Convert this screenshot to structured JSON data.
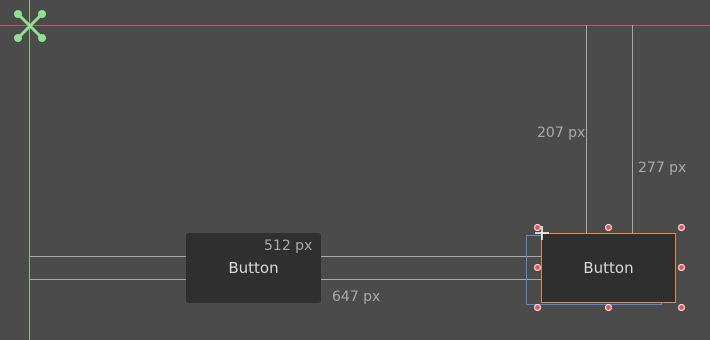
{
  "colors": {
    "background": "#4b4b4b",
    "origin_x_axis": "#b55a6e",
    "origin_y_axis": "#8fbf7a",
    "anchor_icon": "#8fe08f",
    "guide_lines": "#a9a9a9",
    "parent_rect": "#5b86d8",
    "selected_rect": "#e08a4a",
    "handles": "#ff4d4d"
  },
  "editor": {
    "anchor_icon": "anchor-preset-icon",
    "button_label": "Button",
    "selected_button_label": "Button",
    "measurements": {
      "top_left": "512 px",
      "left_edge": "647 px",
      "vertical_1": "207 px",
      "vertical_2": "277 px"
    }
  }
}
